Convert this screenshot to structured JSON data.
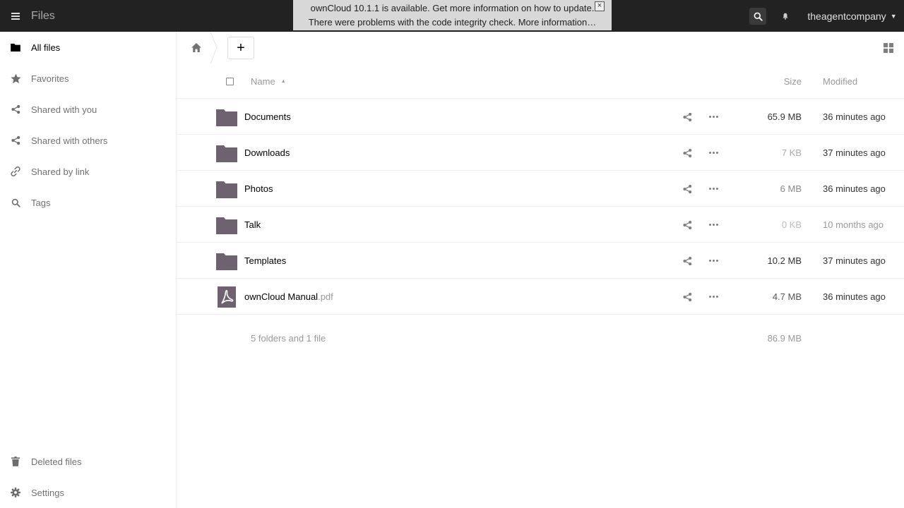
{
  "header": {
    "app_title": "Files",
    "user_name": "theagentcompany",
    "notifications": [
      "ownCloud 10.1.1 is available. Get more information on how to update.",
      "There were problems with the code integrity check. More information…"
    ],
    "close_symbol": "×",
    "icons": {
      "menu": "hamburger-icon",
      "search": "search-icon",
      "bell": "bell-icon",
      "caret": "caret-down-icon"
    }
  },
  "sidebar": {
    "items": [
      {
        "label": "All files",
        "icon": "folder-icon"
      },
      {
        "label": "Favorites",
        "icon": "star-icon"
      },
      {
        "label": "Shared with you",
        "icon": "share-icon"
      },
      {
        "label": "Shared with others",
        "icon": "share-icon"
      },
      {
        "label": "Shared by link",
        "icon": "link-icon"
      },
      {
        "label": "Tags",
        "icon": "search-icon"
      }
    ],
    "bottom": [
      {
        "label": "Deleted files",
        "icon": "trash-icon"
      },
      {
        "label": "Settings",
        "icon": "gear-icon"
      }
    ]
  },
  "controls": {
    "new_label": "+"
  },
  "table": {
    "headers": {
      "name": "Name",
      "size": "Size",
      "modified": "Modified"
    },
    "rows": [
      {
        "name": "Documents",
        "ext": "",
        "type": "folder",
        "size": "65.9 MB",
        "modified": "36 minutes ago"
      },
      {
        "name": "Downloads",
        "ext": "",
        "type": "folder",
        "size": "7 KB",
        "modified": "37 minutes ago"
      },
      {
        "name": "Photos",
        "ext": "",
        "type": "folder",
        "size": "6 MB",
        "modified": "36 minutes ago"
      },
      {
        "name": "Talk",
        "ext": "",
        "type": "folder",
        "size": "0 KB",
        "modified": "10 months ago"
      },
      {
        "name": "Templates",
        "ext": "",
        "type": "folder",
        "size": "10.2 MB",
        "modified": "37 minutes ago"
      },
      {
        "name": "ownCloud Manual",
        "ext": ".pdf",
        "type": "pdf",
        "size": "4.7 MB",
        "modified": "36 minutes ago"
      }
    ],
    "summary": {
      "count": "5 folders and 1 file",
      "total": "86.9 MB"
    }
  },
  "colors": {
    "header_bg": "#222222",
    "notification_bg": "#d8d8d8",
    "folder_icon": "#6e6170",
    "row_border": "#eeeeee",
    "muted_text": "#999999"
  }
}
